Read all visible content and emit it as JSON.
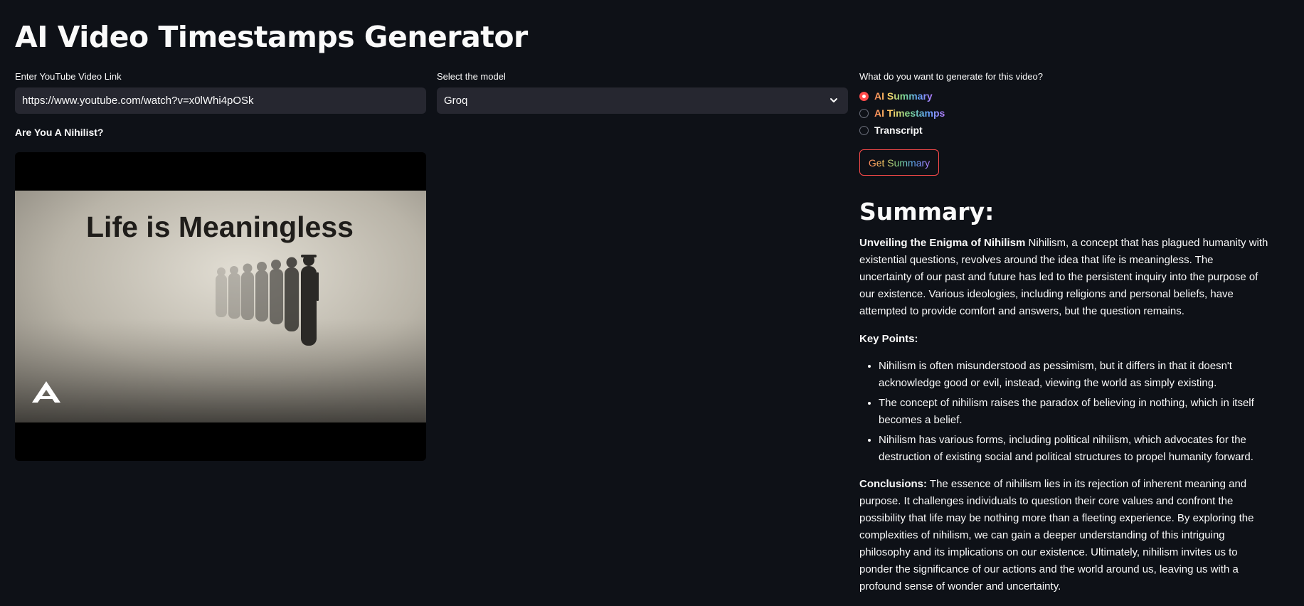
{
  "app": {
    "title": "AI Video Timestamps Generator"
  },
  "link_input": {
    "label": "Enter YouTube Video Link",
    "value": "https://www.youtube.com/watch?v=x0lWhi4pOSk"
  },
  "model_select": {
    "label": "Select the model",
    "value": "Groq"
  },
  "video": {
    "title": "Are You A Nihilist?",
    "thumbnail_text": "Life is Meaningless",
    "channel_logo": "A"
  },
  "generate_options": {
    "label": "What do you want to generate for this video?",
    "options": [
      "AI Summary",
      "AI Timestamps",
      "Transcript"
    ],
    "selected_index": 0
  },
  "action_button": {
    "label": "Get Summary"
  },
  "summary": {
    "heading": "Summary:",
    "intro_bold": "Unveiling the Enigma of Nihilism",
    "intro_text": " Nihilism, a concept that has plagued humanity with existential questions, revolves around the idea that life is meaningless. The uncertainty of our past and future has led to the persistent inquiry into the purpose of our existence. Various ideologies, including religions and personal beliefs, have attempted to provide comfort and answers, but the question remains.",
    "key_points_heading": "Key Points:",
    "key_points": [
      "Nihilism is often misunderstood as pessimism, but it differs in that it doesn't acknowledge good or evil, instead, viewing the world as simply existing.",
      "The concept of nihilism raises the paradox of believing in nothing, which in itself becomes a belief.",
      "Nihilism has various forms, including political nihilism, which advocates for the destruction of existing social and political structures to propel humanity forward."
    ],
    "conclusions_bold": "Conclusions:",
    "conclusions_text": " The essence of nihilism lies in its rejection of inherent meaning and purpose. It challenges individuals to question their core values and confront the possibility that life may be nothing more than a fleeting experience. By exploring the complexities of nihilism, we can gain a deeper understanding of this intriguing philosophy and its implications on our existence. Ultimately, nihilism invites us to ponder the significance of our actions and the world around us, leaving us with a profound sense of wonder and uncertainty."
  },
  "colors": {
    "background": "#0e1117",
    "input_background": "#262730",
    "accent": "#ff4b4b",
    "text": "#fafafa"
  },
  "icons": {
    "select_arrow": "chevron-down-icon"
  }
}
